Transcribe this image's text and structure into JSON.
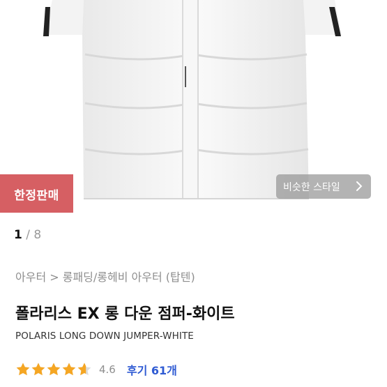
{
  "gallery": {
    "badge": "한정판매",
    "similar_style": "비슷한 스타일",
    "pager": {
      "current": "1",
      "separator": "/",
      "total": "8"
    }
  },
  "product": {
    "breadcrumb": "아우터 > 롱패딩/롱헤비 아우터 (탑텐)",
    "title_ko": "폴라리스 EX 롱 다운 점퍼-화이트",
    "title_en": "POLARIS LONG DOWN JUMPER-WHITE",
    "rating": {
      "value": "4.6",
      "stars": 4.6,
      "reviews": "후기 61개"
    }
  },
  "colors": {
    "badge": "#d65f63",
    "star": "#f5a623",
    "review_link": "#2f5bd3"
  }
}
